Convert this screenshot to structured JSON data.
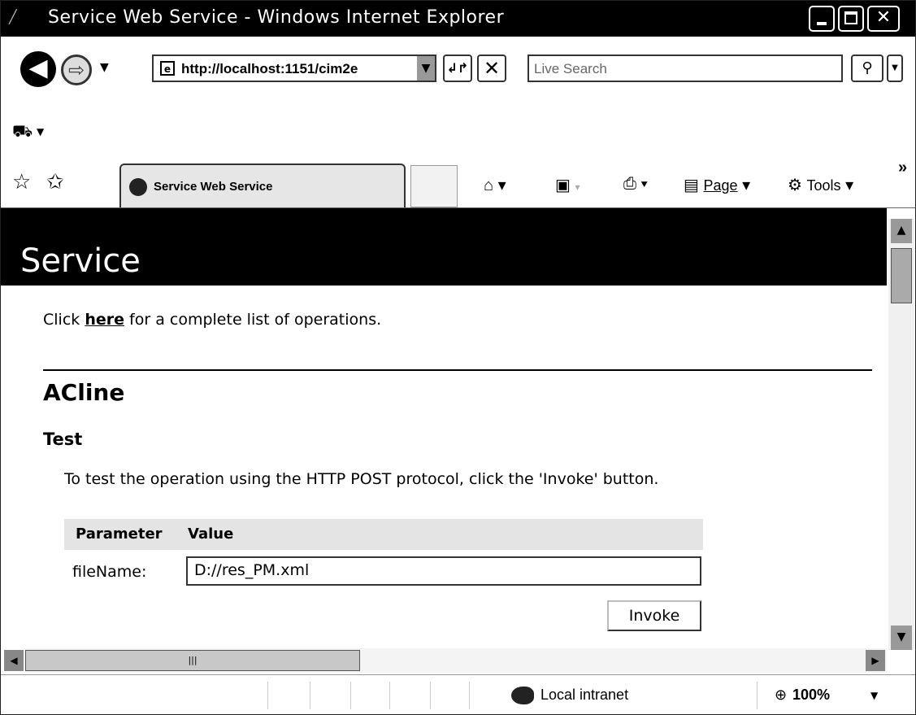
{
  "window": {
    "title": "Service Web Service - Windows Internet Explorer"
  },
  "toolbar": {
    "address_url": "http://localhost:1151/cim2e",
    "search_placeholder": "Live Search"
  },
  "tabs": {
    "active_label": "Service Web Service"
  },
  "command_bar": {
    "page_label": "Page",
    "tools_label": "Tools",
    "more_label": "»"
  },
  "page": {
    "banner_title": "Service",
    "intro_prefix": "Click ",
    "intro_link": "here",
    "intro_suffix": " for a complete list of operations.",
    "operation_name": "ACline",
    "test_heading": "Test",
    "test_description": "To test the operation using the HTTP POST protocol, click the 'Invoke' button.",
    "param_col_label": "Parameter",
    "value_col_label": "Value",
    "param_name": "fileName:",
    "param_value": "D://res_PM.xml",
    "invoke_label": "Invoke"
  },
  "status_bar": {
    "zone": "Local intranet",
    "zoom": "100%"
  },
  "icons": [
    "browser-icon",
    "back-icon",
    "forward-icon",
    "ie-page-icon",
    "dropdown-icon",
    "refresh-icon",
    "stop-icon",
    "search-icon",
    "links-icon",
    "favorites-icon",
    "add-favorites-icon",
    "home-icon",
    "feeds-icon",
    "print-icon",
    "page-icon",
    "tools-icon",
    "zone-icon",
    "zoom-icon"
  ]
}
